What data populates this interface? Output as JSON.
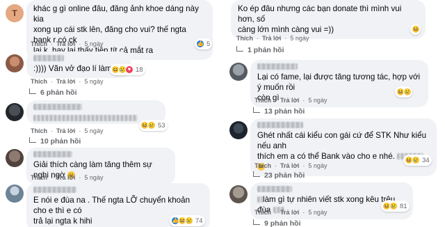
{
  "meta_labels": {
    "like": "Thích",
    "reply": "Trả lời"
  },
  "left": [
    {
      "avatar_letter": "T",
      "lines": [
        "khác g gì online đâu, đăng ảnh khoe dáng này kia",
        "xong up cái stk lên, đăng cho vui? thế ngta bank r có ck",
        "lại k, hay lại thấy tiền tít cả mắt ra"
      ],
      "time": "5 ngày",
      "reactions": [
        "like"
      ],
      "count": "5",
      "replies": ""
    },
    {
      "avatar_letter": "",
      "lines": [
        ":)))) Vãn vở đạo lí làm gì"
      ],
      "time": "5 ngày",
      "reactions": [
        "haha",
        "sad",
        "love"
      ],
      "count": "18",
      "replies": "6 phản hồi"
    },
    {
      "avatar_letter": "",
      "lines": [
        ""
      ],
      "time": "5 ngày",
      "reactions": [
        "haha",
        "sad"
      ],
      "count": "53",
      "replies": "10 phản hồi"
    },
    {
      "avatar_letter": "",
      "lines": [
        "Giải thích càng làm tăng thêm sự nghi ngờ"
      ],
      "time": "5 ngày",
      "reactions": [],
      "count": "",
      "replies": ""
    },
    {
      "avatar_letter": "",
      "lines": [
        "E nói e đùa na . Thế ngta LỠ chuyển khoản cho e thì e có",
        "trả lại ngta k hihi"
      ],
      "time": "5 ngày",
      "reactions": [
        "like",
        "haha",
        "sad"
      ],
      "count": "74",
      "replies": ""
    }
  ],
  "right": [
    {
      "lines": [
        "Ko ép đâu nhưng các bạn donate thì mình vui hơn, số",
        "càng lớn mình càng vui =))"
      ],
      "time": "5 ngày",
      "reactions": [
        "haha"
      ],
      "count": "",
      "replies": "1 phản hồi"
    },
    {
      "lines": [
        "Lại có fame, lại được tăng tương tác, hợp với ý muốn rồi",
        "còn gì"
      ],
      "time": "5 ngày",
      "reactions": [
        "haha",
        "sad"
      ],
      "count": "",
      "replies": "13 phản hồi"
    },
    {
      "lines": [
        "Ghét nhất cái kiểu con gái cứ để STK Như kiểu nếu anh",
        "thích em a có thể Bank vào cho e nhé."
      ],
      "time": "5 ngày",
      "reactions": [
        "haha",
        "sad"
      ],
      "count": "34",
      "replies": "23 phản hồi"
    },
    {
      "lines": [
        "làm gì tự nhiên viết stk xong kêu trêu đùa"
      ],
      "time": "5 ngày",
      "reactions": [
        "haha",
        "sad"
      ],
      "count": "81",
      "replies": "9 phản hồi"
    }
  ]
}
